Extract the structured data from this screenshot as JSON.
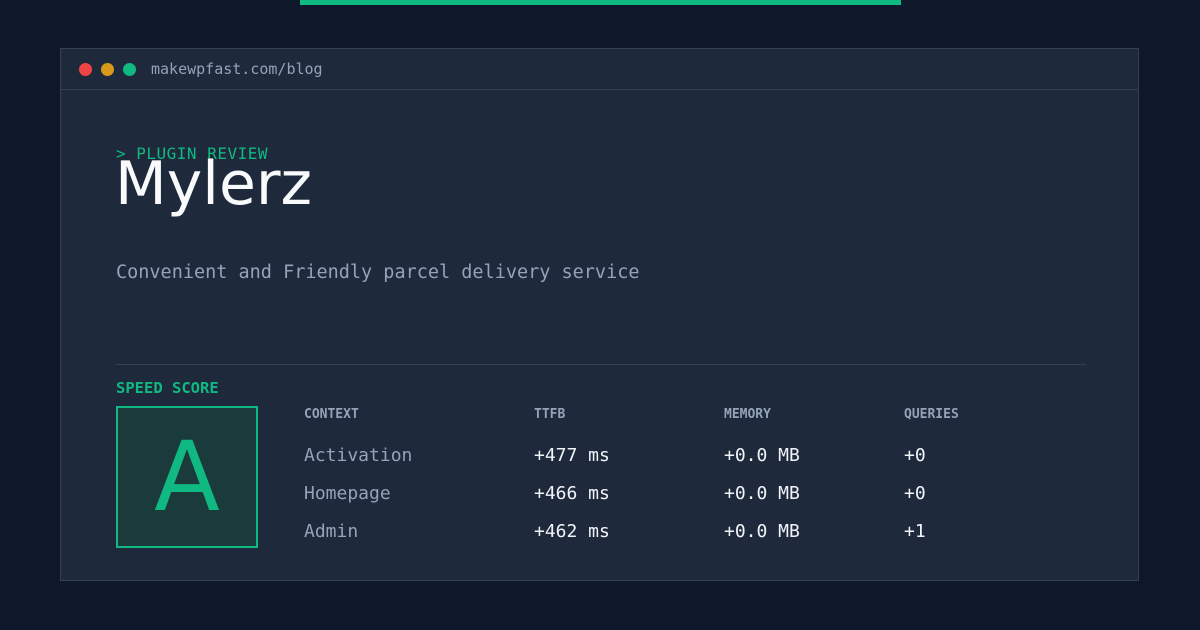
{
  "window": {
    "url": "makewpfast.com/blog"
  },
  "hero": {
    "eyebrow": "> PLUGIN REVIEW",
    "title": "Mylerz",
    "subtitle": "Convenient and Friendly parcel delivery service"
  },
  "speed": {
    "label": "SPEED SCORE",
    "grade": "A"
  },
  "table": {
    "headers": [
      "CONTEXT",
      "TTFB",
      "MEMORY",
      "QUERIES"
    ],
    "rows": [
      [
        "Activation",
        "+477 ms",
        "+0.0 MB",
        "+0"
      ],
      [
        "Homepage",
        "+466 ms",
        "+0.0 MB",
        "+0"
      ],
      [
        "Admin",
        "+462 ms",
        "+0.0 MB",
        "+1"
      ]
    ]
  },
  "colors": {
    "accent": "#10b981",
    "background": "#0f172a",
    "panel": "#1e293b"
  }
}
